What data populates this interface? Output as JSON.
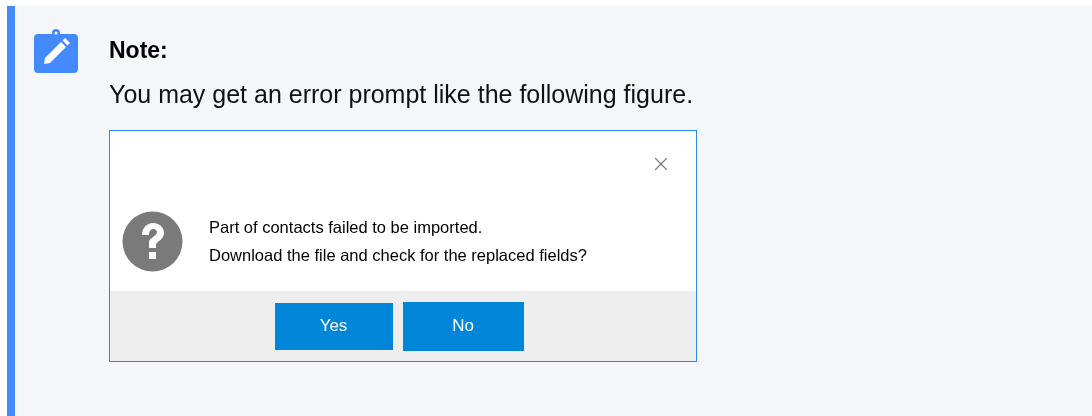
{
  "note": {
    "title": "Note:",
    "text": "You may get an error prompt like the following figure."
  },
  "dialog": {
    "message_lines": [
      "Part of contacts failed to be imported.",
      "Download the file and check for the replaced fields?"
    ],
    "buttons": [
      "Yes",
      "No"
    ]
  }
}
